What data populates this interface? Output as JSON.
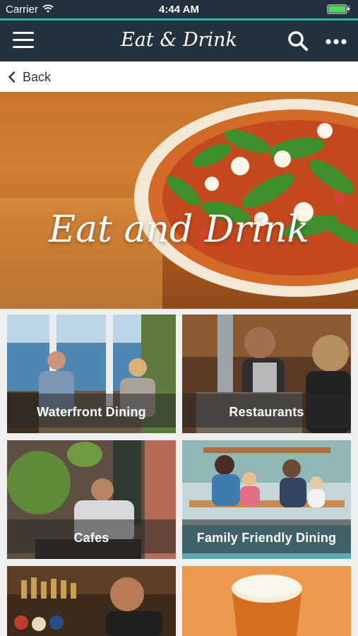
{
  "status_bar": {
    "carrier": "Carrier",
    "time": "4:44 AM"
  },
  "nav": {
    "title": "Eat & Drink",
    "left_icon": "menu-icon",
    "right_icons": [
      "search-icon",
      "more-icon"
    ]
  },
  "back": {
    "label": "Back"
  },
  "hero": {
    "title": "Eat and Drink"
  },
  "tiles": [
    {
      "label": "Waterfront Dining"
    },
    {
      "label": "Restaurants"
    },
    {
      "label": "Cafes"
    },
    {
      "label": "Family Friendly Dining"
    },
    {
      "label": ""
    },
    {
      "label": ""
    }
  ],
  "colors": {
    "nav_background": "#23323d",
    "accent": "#2bb5a8",
    "battery": "#4cd964"
  }
}
